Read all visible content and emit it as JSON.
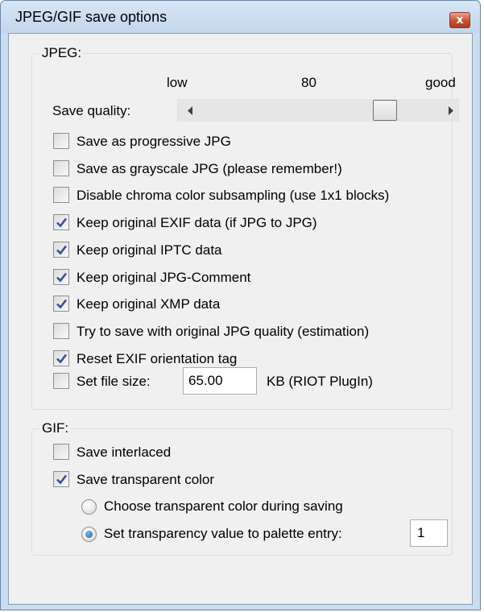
{
  "window": {
    "title": "JPEG/GIF save options",
    "close_label": "x"
  },
  "jpeg": {
    "group_label": "JPEG:",
    "quality": {
      "low_label": "low",
      "value": 80,
      "good_label": "good",
      "label": "Save quality:",
      "min": 0,
      "max": 100
    },
    "options": [
      {
        "label": "Save as progressive JPG",
        "checked": false
      },
      {
        "label": "Save as grayscale JPG (please remember!)",
        "checked": false
      },
      {
        "label": "Disable chroma color subsampling (use 1x1 blocks)",
        "checked": false
      },
      {
        "label": "Keep original EXIF data (if JPG to JPG)",
        "checked": true
      },
      {
        "label": "Keep original IPTC data",
        "checked": true
      },
      {
        "label": "Keep original JPG-Comment",
        "checked": true
      },
      {
        "label": "Keep original XMP data",
        "checked": true
      },
      {
        "label": "Try to save with original JPG quality (estimation)",
        "checked": false
      },
      {
        "label": "Reset EXIF orientation tag",
        "checked": true
      }
    ],
    "file_size": {
      "label": "Set file size:",
      "checked": false,
      "value": "65.00",
      "unit_label": "KB (RIOT PlugIn)"
    }
  },
  "gif": {
    "group_label": "GIF:",
    "save_interlaced": {
      "label": "Save interlaced",
      "checked": false
    },
    "save_transparent": {
      "label": "Save transparent color",
      "checked": true
    },
    "radio_choose": {
      "label": "Choose transparent color during saving",
      "selected": false
    },
    "radio_set": {
      "label": "Set transparency value to palette entry:",
      "selected": true
    },
    "palette_entry": "1"
  },
  "colors": {
    "check_mark": "#3a4f9a",
    "radio_dot": "#1f5fa0"
  }
}
